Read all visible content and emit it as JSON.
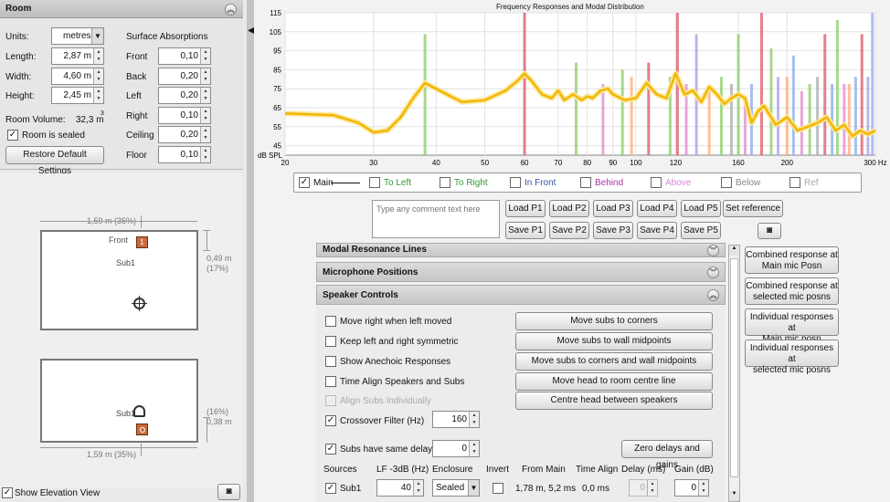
{
  "room": {
    "title": "Room",
    "units_label": "Units:",
    "units_value": "metres",
    "length_label": "Length:",
    "length": "2,87 m",
    "width_label": "Width:",
    "width": "4,60 m",
    "height_label": "Height:",
    "height": "2,45 m",
    "volume_label": "Room Volume:",
    "volume": "32,3 m",
    "volume_exp": "3",
    "sealed_label": "Room is sealed",
    "restore_label": "Restore Default Settings"
  },
  "absorption": {
    "title": "Surface Absorptions",
    "front_label": "Front",
    "front": "0,10",
    "back_label": "Back",
    "back": "0,20",
    "left_label": "Left",
    "left": "0,20",
    "right_label": "Right",
    "right": "0,10",
    "ceiling_label": "Ceiling",
    "ceiling": "0,20",
    "floor_label": "Floor",
    "floor": "0,10"
  },
  "plan": {
    "top_dim": "1,59 m (35%)",
    "front_label": "Front",
    "sub_label": "Sub1",
    "side_dim1": "0,49 m",
    "side_dim2": "(17%)"
  },
  "elevation": {
    "sub_label": "Sub1",
    "side_dim1": "(16%)",
    "side_dim2": "0,38 m",
    "bottom_dim": "1,59 m (35%)",
    "show_label": "Show Elevation View"
  },
  "chart_data": {
    "type": "line",
    "title": "Frequency Responses and Modal Distribution",
    "ylabel": "dB SPL",
    "x_scale": "log",
    "xlim": [
      20,
      300
    ],
    "ylim": [
      40,
      115
    ],
    "grid": true,
    "y_ticks": [
      "115",
      "105",
      "95",
      "85",
      "75",
      "65",
      "55",
      "45"
    ],
    "x_ticks": [
      "20",
      "30",
      "40",
      "50",
      "60",
      "70",
      "80",
      "90",
      "100",
      "120",
      "160",
      "200",
      "300 Hz"
    ],
    "series": [
      {
        "name": "Main",
        "color": "#f2b705",
        "x": [
          20,
          25,
          28,
          30,
          32,
          34,
          36,
          38,
          40,
          45,
          50,
          55,
          58,
          60,
          62,
          65,
          68,
          70,
          72,
          75,
          78,
          80,
          82,
          85,
          88,
          90,
          95,
          100,
          105,
          110,
          115,
          120,
          125,
          130,
          135,
          140,
          145,
          150,
          155,
          160,
          165,
          170,
          175,
          180,
          190,
          200,
          210,
          220,
          230,
          240,
          250,
          260,
          270,
          280,
          290,
          300
        ],
        "y": [
          62,
          61,
          57,
          52,
          53,
          60,
          70,
          78,
          75,
          68,
          69,
          74,
          79,
          83,
          79,
          72,
          70,
          74,
          69,
          72,
          69,
          71,
          70,
          74,
          75,
          72,
          69,
          70,
          78,
          72,
          70,
          83,
          72,
          74,
          68,
          76,
          72,
          67,
          70,
          72,
          70,
          57,
          63,
          66,
          56,
          60,
          53,
          55,
          57,
          60,
          53,
          56,
          50,
          53,
          51,
          53
        ]
      }
    ],
    "modal_lines": [
      {
        "x": 38,
        "color": "#88cc66",
        "h": 0.85
      },
      {
        "x": 60,
        "color": "#dd5566",
        "h": 1.0
      },
      {
        "x": 76,
        "color": "#88cc66",
        "h": 0.65
      },
      {
        "x": 86,
        "color": "#dd88cc",
        "h": 0.5
      },
      {
        "x": 94,
        "color": "#88cc66",
        "h": 0.6
      },
      {
        "x": 98,
        "color": "#ffaa77",
        "h": 0.55
      },
      {
        "x": 106,
        "color": "#dd5566",
        "h": 0.65
      },
      {
        "x": 117,
        "color": "#88cc66",
        "h": 0.55
      },
      {
        "x": 121,
        "color": "#dd5566",
        "h": 1.0
      },
      {
        "x": 126,
        "color": "#dd88cc",
        "h": 0.5
      },
      {
        "x": 132,
        "color": "#aa99ee",
        "h": 0.85
      },
      {
        "x": 140,
        "color": "#ffaa77",
        "h": 0.45
      },
      {
        "x": 148,
        "color": "#88cc66",
        "h": 0.55
      },
      {
        "x": 155,
        "color": "#aaaaaa",
        "h": 0.5
      },
      {
        "x": 160,
        "color": "#88cc66",
        "h": 0.85
      },
      {
        "x": 165,
        "color": "#dd88cc",
        "h": 0.4
      },
      {
        "x": 170,
        "color": "#88aaee",
        "h": 0.5
      },
      {
        "x": 178,
        "color": "#dd5566",
        "h": 1.0
      },
      {
        "x": 186,
        "color": "#88cc66",
        "h": 0.75
      },
      {
        "x": 192,
        "color": "#aa99ee",
        "h": 0.55
      },
      {
        "x": 200,
        "color": "#ffaa77",
        "h": 0.55
      },
      {
        "x": 206,
        "color": "#88aaee",
        "h": 0.7
      },
      {
        "x": 214,
        "color": "#dd88cc",
        "h": 0.45
      },
      {
        "x": 222,
        "color": "#88cc66",
        "h": 0.5
      },
      {
        "x": 230,
        "color": "#aaaaaa",
        "h": 0.55
      },
      {
        "x": 238,
        "color": "#dd5566",
        "h": 0.85
      },
      {
        "x": 246,
        "color": "#88aaee",
        "h": 0.5
      },
      {
        "x": 252,
        "color": "#88cc66",
        "h": 0.95
      },
      {
        "x": 260,
        "color": "#dd88cc",
        "h": 0.5
      },
      {
        "x": 266,
        "color": "#ffaa77",
        "h": 0.5
      },
      {
        "x": 274,
        "color": "#88aaee",
        "h": 0.55
      },
      {
        "x": 282,
        "color": "#dd5566",
        "h": 0.85
      },
      {
        "x": 290,
        "color": "#aa99ee",
        "h": 0.55
      },
      {
        "x": 296,
        "color": "#88aaee",
        "h": 1.0
      }
    ]
  },
  "legend": [
    {
      "label": "Main",
      "color": "#111111",
      "checked": true
    },
    {
      "label": "To Left",
      "color": "#339933",
      "checked": false
    },
    {
      "label": "To Right",
      "color": "#339933",
      "checked": false
    },
    {
      "label": "In Front",
      "color": "#3355aa",
      "checked": false
    },
    {
      "label": "Behind",
      "color": "#aa33aa",
      "checked": false
    },
    {
      "label": "Above",
      "color": "#dd88dd",
      "checked": false
    },
    {
      "label": "Below",
      "color": "#888888",
      "checked": false
    },
    {
      "label": "Ref",
      "color": "#aaaaaa",
      "checked": false
    }
  ],
  "comment": {
    "placeholder": "Type any comment text here"
  },
  "load": [
    "Load P1",
    "Load P2",
    "Load P3",
    "Load P4",
    "Load P5"
  ],
  "save": [
    "Save P1",
    "Save P2",
    "Save P3",
    "Save P4",
    "Save P5"
  ],
  "set_reference": "Set reference",
  "sections": {
    "modal": "Modal Resonance Lines",
    "mic": "Microphone Positions",
    "speaker": "Speaker Controls"
  },
  "speaker": {
    "opt1": "Move right when left moved",
    "opt2": "Keep left and right symmetric",
    "opt3": "Show Anechoic Responses",
    "opt4": "Time Align Speakers and Subs",
    "opt5": "Align Subs Individually",
    "crossover_label": "Crossover Filter (Hz)",
    "crossover": "160",
    "same_delay_label": "Subs have same delay",
    "same_delay": "0",
    "btn1": "Move subs to corners",
    "btn2": "Move subs to wall midpoints",
    "btn3": "Move subs to corners and wall midpoints",
    "btn4": "Move head to room centre line",
    "btn5": "Centre head between speakers",
    "zero_btn": "Zero delays and gains",
    "cols": [
      "Sources",
      "LF -3dB (Hz)",
      "Enclosure",
      "Invert",
      "From Main",
      "Time Align",
      "Delay (ms)",
      "Gain (dB)"
    ],
    "row": {
      "name": "Sub1",
      "lf": "40",
      "enclosure": "Sealed",
      "from_main": "1,78 m, 5,2 ms",
      "time_align": "0,0 ms",
      "delay": "0",
      "gain": "0"
    }
  },
  "side_buttons": [
    [
      "Combined response at",
      "Main mic Posn"
    ],
    [
      "Combined response at",
      "selected mic posns"
    ],
    [
      "Individual responses at",
      "Main mic posn"
    ],
    [
      "Individual responses at",
      "selected mic posns"
    ]
  ]
}
